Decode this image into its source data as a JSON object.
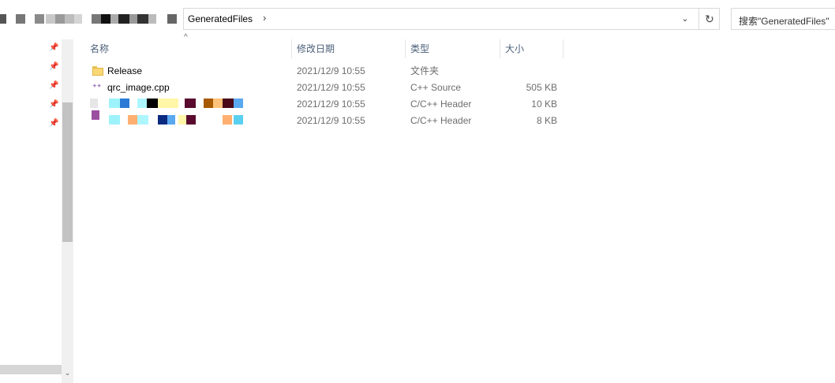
{
  "address_bar": {
    "current_folder": "GeneratedFiles",
    "separator": "›",
    "dropdown_glyph": "⌄",
    "refresh_glyph": "↻"
  },
  "search": {
    "placeholder": "搜索\"GeneratedFiles\""
  },
  "nav_pane": {
    "pin_glyph": "📌",
    "scroll_down_glyph": "⌄"
  },
  "file_list": {
    "sort_glyph": "^",
    "columns": {
      "name": "名称",
      "date": "修改日期",
      "type": "类型",
      "size": "大小"
    },
    "rows": [
      {
        "name": "Release",
        "date": "2021/12/9 10:55",
        "type": "文件夹",
        "size": "",
        "icon": "folder-icon"
      },
      {
        "name": "qrc_image.cpp",
        "date": "2021/12/9 10:55",
        "type": "C++ Source",
        "size": "505 KB",
        "icon": "cpp-file-icon"
      },
      {
        "name": "",
        "date": "2021/12/9 10:55",
        "type": "C/C++ Header",
        "size": "10 KB",
        "icon": "header-file-icon"
      },
      {
        "name": "",
        "date": "2021/12/9 10:55",
        "type": "C/C++ Header",
        "size": "8 KB",
        "icon": "header-file-icon"
      }
    ]
  },
  "colors": {
    "header_text": "#4c607a",
    "detail_text": "#6d6d6d",
    "border": "#d9d9d9",
    "folder": "#f9d775",
    "cpp_icon": "#7a3e9d"
  }
}
